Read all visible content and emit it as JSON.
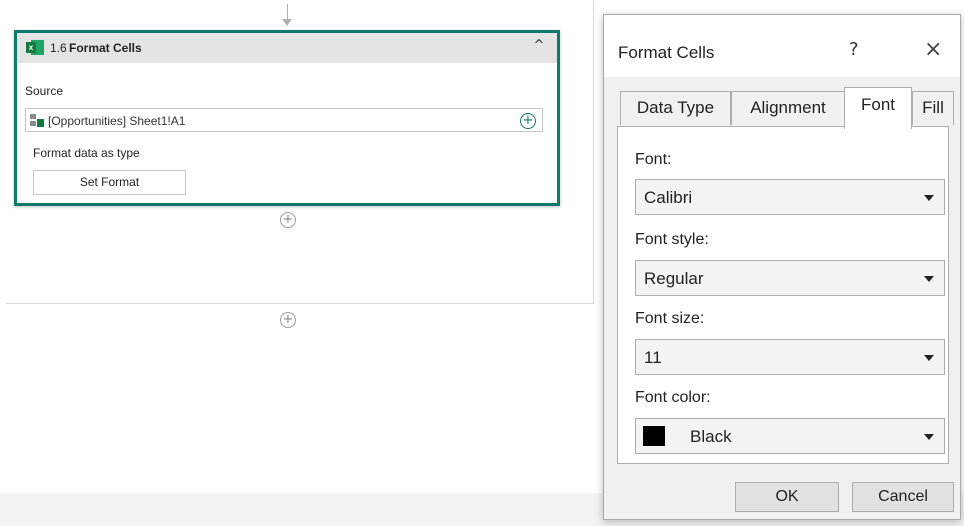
{
  "action_card": {
    "number": "1.6",
    "title": "Format Cells",
    "source_label": "Source",
    "source_value": "[Opportunities] Sheet1!A1",
    "format_label": "Format data as type",
    "set_format_button": "Set Format"
  },
  "dialog": {
    "title": "Format Cells",
    "help_glyph": "?",
    "close_glyph": "×",
    "tabs": [
      {
        "label": "Data Type",
        "active": false
      },
      {
        "label": "Alignment",
        "active": false
      },
      {
        "label": "Font",
        "active": true
      },
      {
        "label": "Fill",
        "active": false
      }
    ],
    "fields": {
      "font_label": "Font:",
      "font_value": "Calibri",
      "style_label": "Font style:",
      "style_value": "Regular",
      "size_label": "Font size:",
      "size_value": "11",
      "color_label": "Font color:",
      "color_value": "Black",
      "color_swatch": "#000000"
    },
    "ok_button": "OK",
    "cancel_button": "Cancel"
  },
  "colors": {
    "card_border": "#0f7a6b",
    "excel_green": "#107c41"
  },
  "icons": {
    "excel": "excel-icon",
    "add": "add-circle-icon",
    "collapse": "chevron-up-icon",
    "down_arrow": "arrow-down-icon",
    "excel_range": "excel-range-icon"
  }
}
